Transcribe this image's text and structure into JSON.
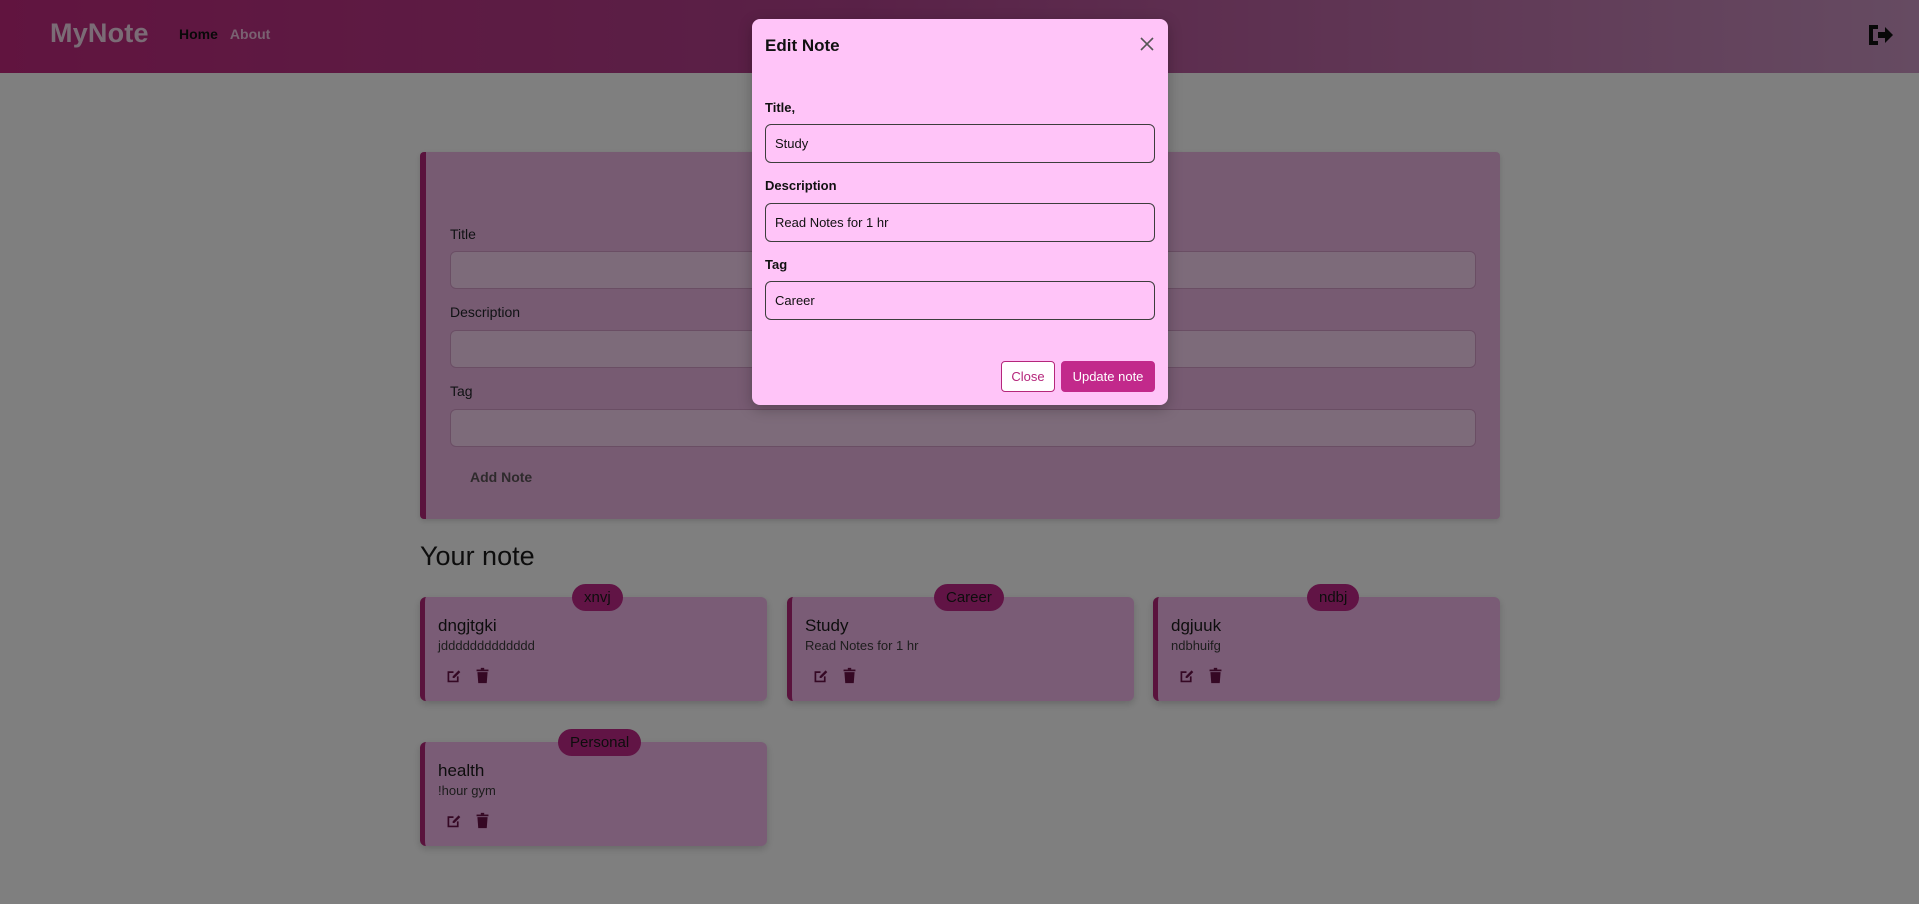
{
  "navbar": {
    "brand": "MyNote",
    "links": [
      {
        "label": "Home",
        "active": true
      },
      {
        "label": "About",
        "active": false
      }
    ],
    "logout_icon": "sign-out-icon"
  },
  "add_form": {
    "title_label": "Title",
    "description_label": "Description",
    "tag_label": "Tag",
    "submit_label": "Add Note"
  },
  "notes_section": {
    "heading": "Your note"
  },
  "notes": [
    {
      "tag": "xnvj",
      "title": "dngjtgki",
      "description": "jddddddddddddd"
    },
    {
      "tag": "Career",
      "title": "Study",
      "description": "Read Notes for 1 hr"
    },
    {
      "tag": "ndbj",
      "title": "dgjuuk",
      "description": "ndbhuifg"
    },
    {
      "tag": "Personal",
      "title": "health",
      "description": "!hour gym"
    }
  ],
  "modal": {
    "title": "Edit Note",
    "title_label": "Title,",
    "title_value": "Study",
    "description_label": "Description",
    "description_value": "Read Notes for 1 hr",
    "tag_label": "Tag",
    "tag_value": "Career",
    "close_label": "Close",
    "update_label": "Update note"
  },
  "colors": {
    "accent": "#c2298b",
    "modal_bg": "#ffc4f8",
    "card_bg": "#f4b9ec"
  }
}
